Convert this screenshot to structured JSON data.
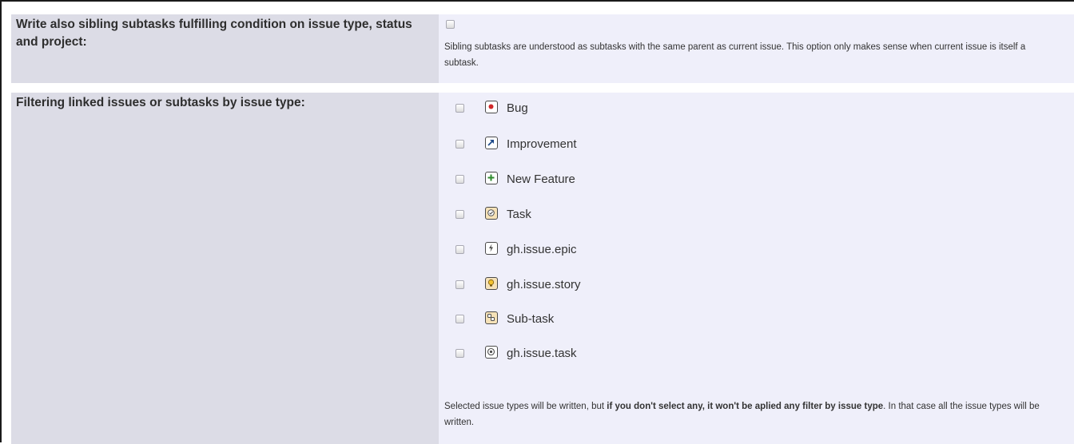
{
  "sibling_option": {
    "label": "Write also sibling subtasks fulfilling condition on issue type, status and project:",
    "checked": false,
    "description": "Sibling subtasks are understood as subtasks with the same parent as current issue. This option only makes sense when current issue is itself a subtask."
  },
  "issue_type_filter": {
    "label": "Filtering linked issues or subtasks by issue type:",
    "types": [
      {
        "name": "Bug",
        "icon": "bug-icon",
        "checked": false
      },
      {
        "name": "Improvement",
        "icon": "improvement-arrow-icon",
        "checked": false
      },
      {
        "name": "New Feature",
        "icon": "new-feature-plus-icon",
        "checked": false
      },
      {
        "name": "Task",
        "icon": "task-check-icon",
        "checked": false
      },
      {
        "name": "gh.issue.epic",
        "icon": "epic-lightning-icon",
        "checked": false
      },
      {
        "name": "gh.issue.story",
        "icon": "story-lightbulb-icon",
        "checked": false
      },
      {
        "name": "Sub-task",
        "icon": "subtask-icon",
        "checked": false
      },
      {
        "name": "gh.issue.task",
        "icon": "gh-task-target-icon",
        "checked": false
      }
    ],
    "description_prefix": "Selected issue types will be written, but ",
    "description_bold": "if you don't select any, it won't be aplied any filter by issue type",
    "description_suffix": ". In that case all the issue types will be written."
  },
  "colors": {
    "label_bg": "#dcdce6",
    "value_bg": "#efeffa",
    "bug_red": "#d0282a",
    "improvement_blue": "#1f4a8a",
    "feature_green": "#2e8b2e",
    "task_orange": "#d48a1a"
  }
}
